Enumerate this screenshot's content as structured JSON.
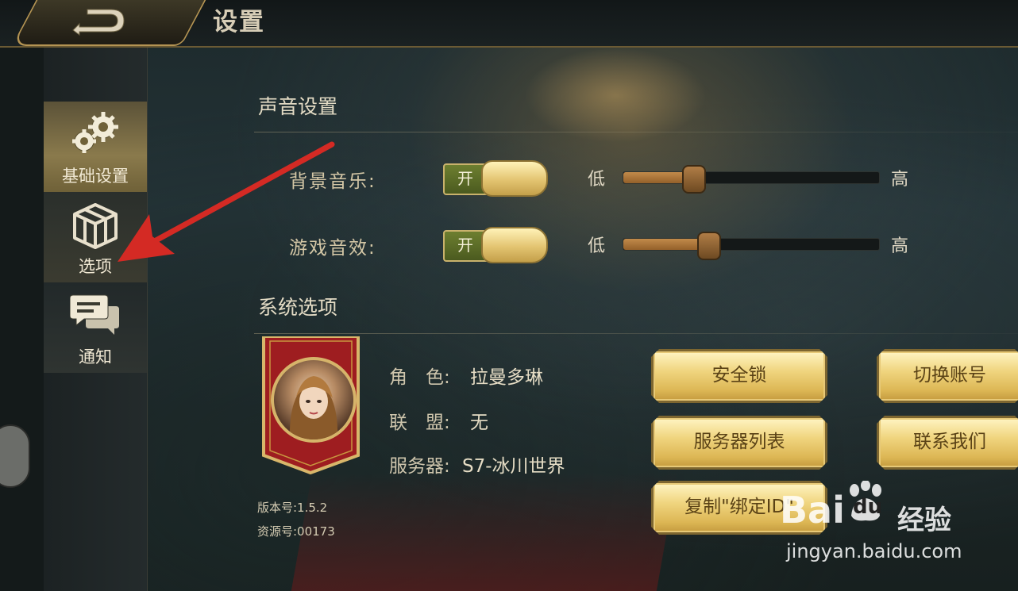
{
  "window": {
    "title": "设置"
  },
  "sidebar": {
    "items": [
      {
        "label": "基础设置",
        "icon": "gears-icon",
        "active": true
      },
      {
        "label": "选项",
        "icon": "cube-icon",
        "active": false
      },
      {
        "label": "通知",
        "icon": "chat-bubbles-icon",
        "active": false
      }
    ]
  },
  "sound": {
    "title": "声音设置",
    "rows": [
      {
        "label": "背景音乐:",
        "toggle": "开",
        "low": "低",
        "high": "高",
        "level": 0.27
      },
      {
        "label": "游戏音效:",
        "toggle": "开",
        "low": "低",
        "high": "高",
        "level": 0.33
      }
    ]
  },
  "system": {
    "title": "系统选项",
    "role_label": "角　色:",
    "role_value": "拉曼多琳",
    "alliance_label": "联　盟:",
    "alliance_value": "无",
    "server_label": "服务器:",
    "server_value": "S7-冰川世界",
    "version": "版本号:1.5.2",
    "resource": "资源号:00173",
    "buttons": {
      "lock": "安全锁",
      "switch_account": "切换账号",
      "server_list": "服务器列表",
      "contact_us": "联系我们",
      "copy_bind_id": "复制\"绑定ID\""
    }
  },
  "watermark": {
    "brand": "Bai",
    "brand2": "du",
    "cn": "经验",
    "url": "jingyan.baidu.com"
  },
  "colors": {
    "gold": "#e3c471",
    "toggle_green": "#5b6c27",
    "annotation_arrow": "#d42a24"
  }
}
